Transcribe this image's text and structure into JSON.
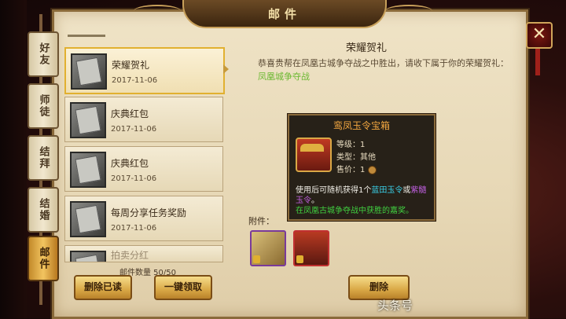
{
  "title": "邮件",
  "close_label": "✕",
  "tabs": [
    {
      "label": "好友",
      "active": false
    },
    {
      "label": "师徒",
      "active": false
    },
    {
      "label": "结拜",
      "active": false
    },
    {
      "label": "结婚",
      "active": false
    },
    {
      "label": "邮件",
      "active": true
    }
  ],
  "mails": [
    {
      "title": "荣耀贺礼",
      "date": "2017-11-06",
      "selected": true
    },
    {
      "title": "庆典红包",
      "date": "2017-11-06",
      "selected": false
    },
    {
      "title": "庆典红包",
      "date": "2017-11-06",
      "selected": false
    },
    {
      "title": "每周分享任务奖励",
      "date": "2017-11-06",
      "selected": false
    },
    {
      "title": "拍卖分红",
      "date": "",
      "selected": false
    }
  ],
  "mail_count": "邮件数量 50/50",
  "buttons": {
    "delete_read": "删除已读",
    "claim_all": "一键领取",
    "delete": "删除"
  },
  "detail": {
    "heading": "荣耀贺礼",
    "body": "恭喜贵帮在凤凰古城争夺战之中胜出，请收下属于你的荣耀贺礼：",
    "highlight": "凤凰城争夺战",
    "attachments_label": "附件："
  },
  "tooltip": {
    "name": "鸾凤玉令宝箱",
    "level": "等级：1",
    "type": "类型：其他",
    "price_label": "售价：1",
    "desc_1": "使用后可随机获得1个",
    "item_cyan": "蓝田玉令",
    "desc_or": "或",
    "item_purple": "紫髓玉令",
    "desc_end": "。",
    "desc_green": "在凤凰古城争夺战中获胜的嘉奖。"
  },
  "watermark": "头条号",
  "colors": {
    "accent_gold": "#e1b030",
    "tooltip_title": "#f2a640"
  }
}
